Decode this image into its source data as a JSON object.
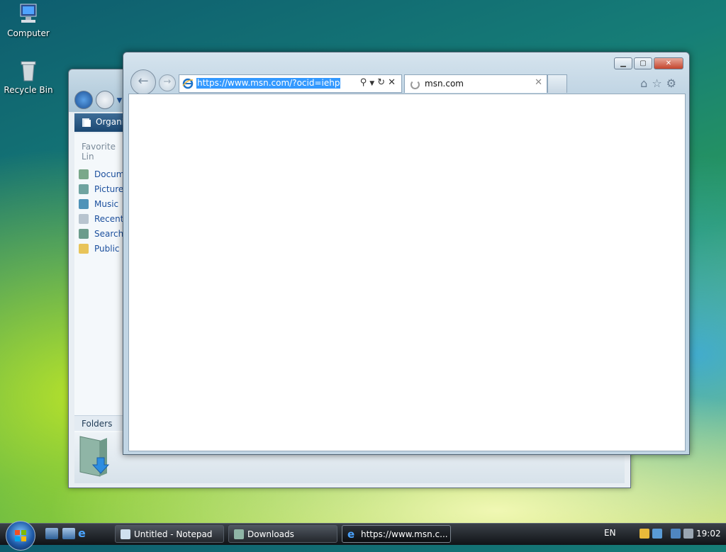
{
  "desktop": {
    "icons": [
      {
        "label": "Computer"
      },
      {
        "label": "Recycle Bin"
      }
    ]
  },
  "explorer": {
    "toolbar_label": "Organiz",
    "favorites_heading": "Favorite Lin",
    "favorite_items": [
      {
        "label": "Docum"
      },
      {
        "label": "Pictures"
      },
      {
        "label": "Music"
      },
      {
        "label": "Recentl"
      },
      {
        "label": "Searche"
      },
      {
        "label": "Public"
      }
    ],
    "folders_label": "Folders"
  },
  "ie": {
    "address_url": "https://www.msn.com/?ocid=iehp",
    "tab_title": "msn.com"
  },
  "taskbar": {
    "buttons": [
      {
        "label": "Untitled - Notepad"
      },
      {
        "label": "Downloads"
      },
      {
        "label": "https://www.msn.c..."
      }
    ],
    "language": "EN",
    "clock": "19:02"
  },
  "colors": {
    "selection": "#3399ff",
    "link": "#1b4f9d",
    "close_button": "#c4442d"
  }
}
